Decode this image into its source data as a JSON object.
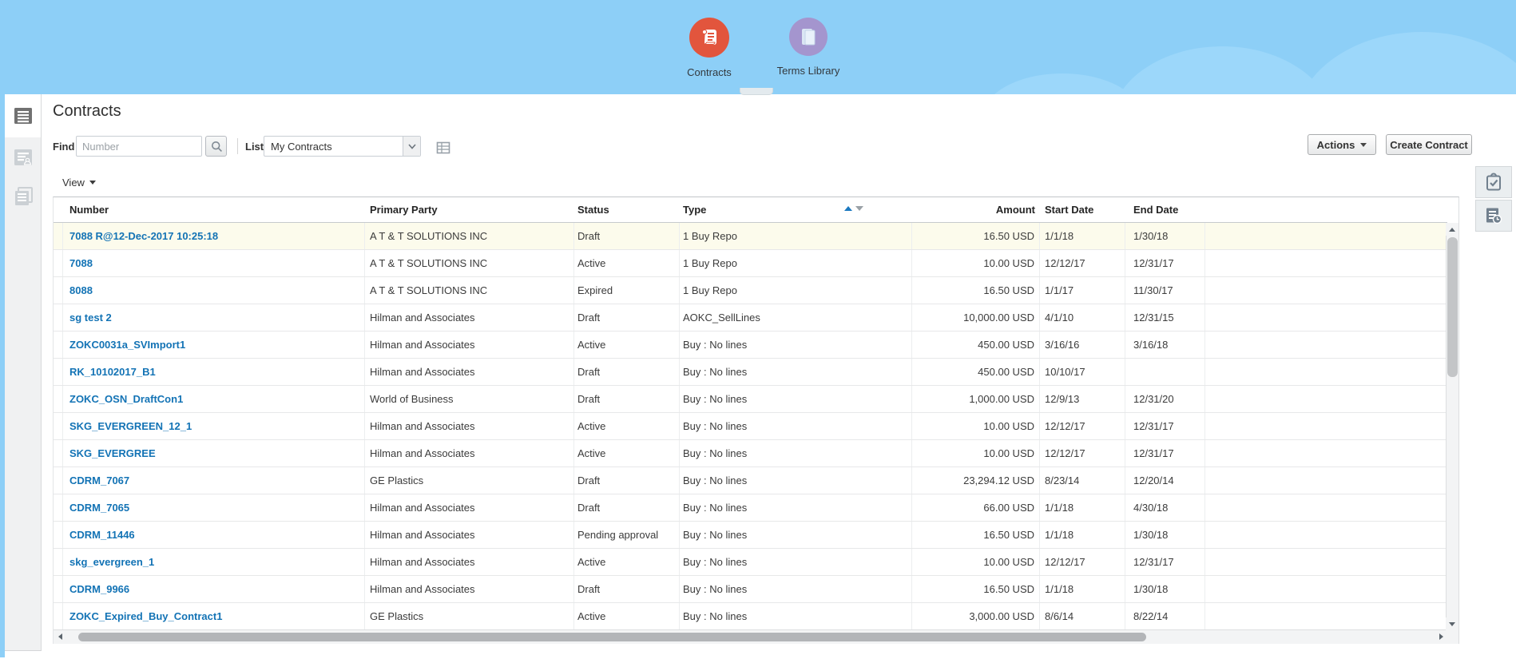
{
  "banner": {
    "apps": [
      {
        "label": "Contracts",
        "icon": "contracts-scroll-icon",
        "circle_color": "#E2553D"
      },
      {
        "label": "Terms Library",
        "icon": "terms-library-book-icon",
        "circle_color": "#A495CE"
      }
    ]
  },
  "left_rail_icons": [
    "contract-list-icon",
    "contract-person-icon",
    "contract-copy-icon"
  ],
  "right_rail_icons": [
    "clipboard-check-icon",
    "document-clock-icon"
  ],
  "page_title": "Contracts",
  "toolbar": {
    "find_label": "Find",
    "find_placeholder": "Number",
    "search_icon": "magnifier-icon",
    "list_label": "List",
    "list_value": "My Contracts",
    "qbe_icon": "query-by-example-grid-icon",
    "actions_label": "Actions",
    "create_contract_label": "Create Contract"
  },
  "view_menu_label": "View",
  "table": {
    "columns": [
      "Number",
      "Primary Party",
      "Status",
      "Type",
      "Amount",
      "Start Date",
      "End Date"
    ],
    "sort_indicator_column": "Type",
    "rows": [
      {
        "selected": true,
        "number": "7088 R@12-Dec-2017 10:25:18",
        "primary_party": "A T & T SOLUTIONS INC",
        "status": "Draft",
        "type": "1 Buy Repo",
        "amount": "16.50 USD",
        "start_date": "1/1/18",
        "end_date": "1/30/18"
      },
      {
        "selected": false,
        "number": "7088",
        "primary_party": "A T & T SOLUTIONS INC",
        "status": "Active",
        "type": "1 Buy Repo",
        "amount": "10.00 USD",
        "start_date": "12/12/17",
        "end_date": "12/31/17"
      },
      {
        "selected": false,
        "number": "8088",
        "primary_party": "A T & T SOLUTIONS INC",
        "status": "Expired",
        "type": "1 Buy Repo",
        "amount": "16.50 USD",
        "start_date": "1/1/17",
        "end_date": "11/30/17"
      },
      {
        "selected": false,
        "number": "sg test 2",
        "primary_party": "Hilman and Associates",
        "status": "Draft",
        "type": "AOKC_SellLines",
        "amount": "10,000.00 USD",
        "start_date": "4/1/10",
        "end_date": "12/31/15"
      },
      {
        "selected": false,
        "number": "ZOKC0031a_SVImport1",
        "primary_party": "Hilman and Associates",
        "status": "Active",
        "type": "Buy : No lines",
        "amount": "450.00 USD",
        "start_date": "3/16/16",
        "end_date": "3/16/18"
      },
      {
        "selected": false,
        "number": "RK_10102017_B1",
        "primary_party": "Hilman and Associates",
        "status": "Draft",
        "type": "Buy : No lines",
        "amount": "450.00 USD",
        "start_date": "10/10/17",
        "end_date": ""
      },
      {
        "selected": false,
        "number": "ZOKC_OSN_DraftCon1",
        "primary_party": "World of Business",
        "status": "Draft",
        "type": "Buy : No lines",
        "amount": "1,000.00 USD",
        "start_date": "12/9/13",
        "end_date": "12/31/20"
      },
      {
        "selected": false,
        "number": "SKG_EVERGREEN_12_1",
        "primary_party": "Hilman and Associates",
        "status": "Active",
        "type": "Buy : No lines",
        "amount": "10.00 USD",
        "start_date": "12/12/17",
        "end_date": "12/31/17"
      },
      {
        "selected": false,
        "number": "SKG_EVERGREE",
        "primary_party": "Hilman and Associates",
        "status": "Active",
        "type": "Buy : No lines",
        "amount": "10.00 USD",
        "start_date": "12/12/17",
        "end_date": "12/31/17"
      },
      {
        "selected": false,
        "number": "CDRM_7067",
        "primary_party": "GE Plastics",
        "status": "Draft",
        "type": "Buy : No lines",
        "amount": "23,294.12 USD",
        "start_date": "8/23/14",
        "end_date": "12/20/14"
      },
      {
        "selected": false,
        "number": "CDRM_7065",
        "primary_party": "Hilman and Associates",
        "status": "Draft",
        "type": "Buy : No lines",
        "amount": "66.00 USD",
        "start_date": "1/1/18",
        "end_date": "4/30/18"
      },
      {
        "selected": false,
        "number": "CDRM_11446",
        "primary_party": "Hilman and Associates",
        "status": "Pending approval",
        "type": "Buy : No lines",
        "amount": "16.50 USD",
        "start_date": "1/1/18",
        "end_date": "1/30/18"
      },
      {
        "selected": false,
        "number": "skg_evergreen_1",
        "primary_party": "Hilman and Associates",
        "status": "Active",
        "type": "Buy : No lines",
        "amount": "10.00 USD",
        "start_date": "12/12/17",
        "end_date": "12/31/17"
      },
      {
        "selected": false,
        "number": "CDRM_9966",
        "primary_party": "Hilman and Associates",
        "status": "Draft",
        "type": "Buy : No lines",
        "amount": "16.50 USD",
        "start_date": "1/1/18",
        "end_date": "1/30/18"
      },
      {
        "selected": false,
        "number": "ZOKC_Expired_Buy_Contract1",
        "primary_party": "GE Plastics",
        "status": "Active",
        "type": "Buy : No lines",
        "amount": "3,000.00 USD",
        "start_date": "8/6/14",
        "end_date": "8/22/14"
      }
    ]
  },
  "colors": {
    "banner_blue": "#8DCFF7",
    "app_contracts_circle": "#E2553D",
    "app_terms_circle": "#A495CE",
    "link_blue": "#1373B5",
    "selected_row_bg": "#FCFBEC"
  }
}
